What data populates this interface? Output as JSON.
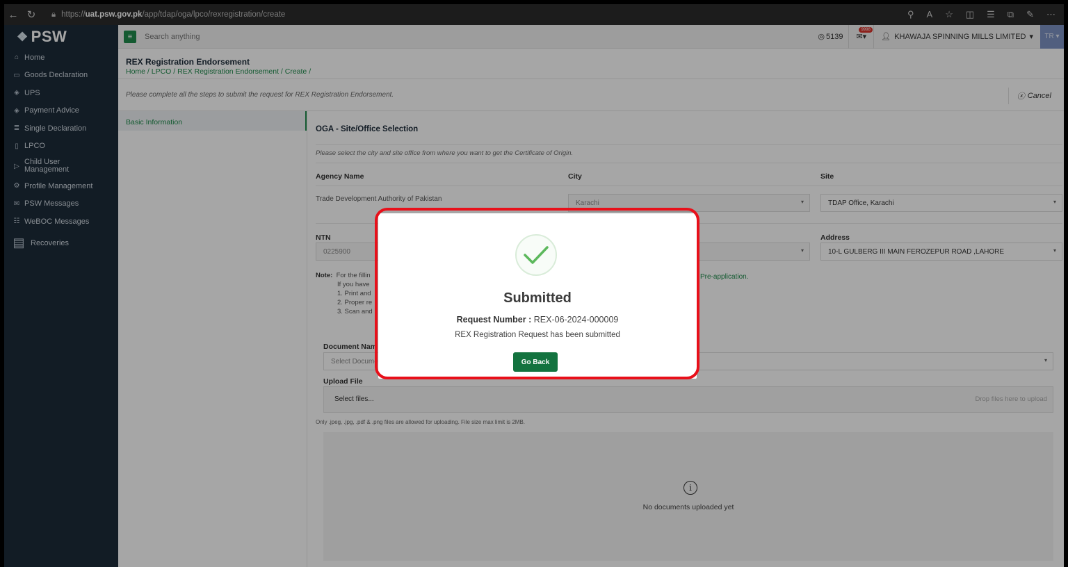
{
  "browser": {
    "url_prefix": "https://",
    "url_host": "uat.psw.gov.pk",
    "url_path": "/app/tdap/oga/lpco/rexregistration/create"
  },
  "sidebar": {
    "brand": "PSW",
    "items": [
      {
        "label": "Home",
        "icon": "home-icon"
      },
      {
        "label": "Goods Declaration",
        "icon": "document-icon"
      },
      {
        "label": "UPS",
        "icon": "diamond-icon"
      },
      {
        "label": "Payment Advice",
        "icon": "diamond-icon"
      },
      {
        "label": "Single Declaration",
        "icon": "stack-icon"
      },
      {
        "label": "LPCO",
        "icon": "file-icon"
      },
      {
        "label": "Child User Management",
        "icon": "user-edit-icon"
      },
      {
        "label": "Profile Management",
        "icon": "gear-icon"
      },
      {
        "label": "PSW Messages",
        "icon": "message-icon"
      },
      {
        "label": "WeBOC Messages",
        "icon": "chat-icon"
      },
      {
        "label": "Recoveries",
        "icon": "recoveries-icon"
      }
    ]
  },
  "topbar": {
    "search_placeholder": "Search anything",
    "points": "5139",
    "mail_badge": "9998",
    "user_name": "KHAWAJA SPINNING MILLS LIMITED",
    "user_initials": "TR"
  },
  "header": {
    "title": "REX Registration Endorsement",
    "breadcrumb": "Home / LPCO / REX Registration Endorsement / Create /"
  },
  "instruction": "Please complete all the steps to submit the request for REX Registration Endorsement.",
  "cancel_label": "Cancel",
  "steps": [
    "Basic Information"
  ],
  "form": {
    "section_title": "OGA - Site/Office Selection",
    "hint": "Please select the city and site office from where you want to get the Certificate of Origin.",
    "agency_label": "Agency Name",
    "agency_value": "Trade Development Authority of Pakistan",
    "city_label": "City",
    "city_value": "Karachi",
    "site_label": "Site",
    "site_value": "TDAP Office, Karachi",
    "ntn_label": "NTN",
    "ntn_value": "0225900",
    "address_label": "Address",
    "address_value": "10-L GULBERG III MAIN FEROZEPUR ROAD ,LAHORE",
    "note_label": "Note:",
    "note_lines": [
      "For the fillin",
      "If you have",
      "1. Print and",
      "2. Proper re",
      "3. Scan and"
    ],
    "note_link": "Pre-application.",
    "document_label": "Document Nam",
    "document_placeholder": "Select Docume",
    "upload_label": "Upload File",
    "select_files": "Select files...",
    "drop_text": "Drop files here to upload",
    "file_rule": "Only .jpeg, .jpg, .pdf & .png files are allowed for uploading. File size max limit is 2MB.",
    "empty_text": "No documents uploaded yet"
  },
  "modal": {
    "title": "Submitted",
    "request_label": "Request Number :",
    "request_number": "REX-06-2024-000009",
    "message": "REX Registration Request has been submitted",
    "button": "Go Back"
  },
  "colors": {
    "accent": "#1f8b4c",
    "sidebar": "#1d2b3a",
    "highlight": "#e8101a"
  }
}
